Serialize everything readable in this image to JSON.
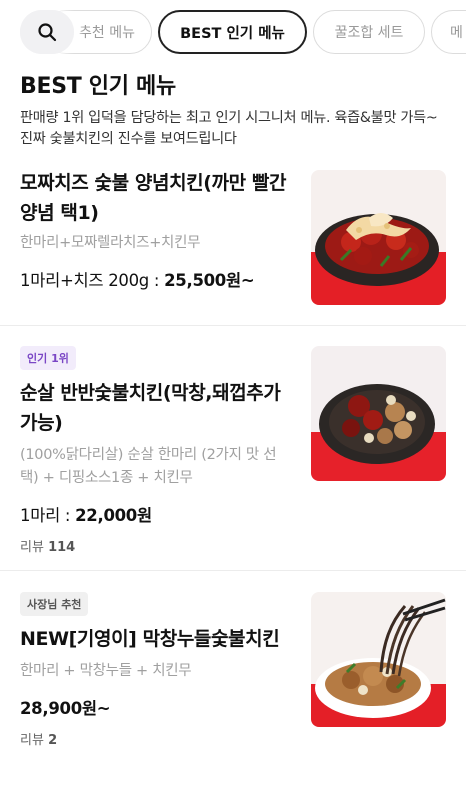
{
  "tabs": {
    "search_icon": "search-icon",
    "items": [
      {
        "label": "추천 메뉴",
        "active": false
      },
      {
        "label": "BEST 인기 메뉴",
        "active": true
      },
      {
        "label": "꿀조합 세트",
        "active": false
      },
      {
        "label": "메",
        "active": false
      }
    ]
  },
  "section": {
    "title": "BEST 인기 메뉴",
    "description": "판매량 1위 입덕을 담당하는 최고 인기 시그니처 메뉴. 육즙&불맛 가득~ 진짜 숯불치킨의 진수를 보여드립니다"
  },
  "menu_items": [
    {
      "name": "모짜치즈 숯불 양념치킨(까만 빨간양념 택1)",
      "description": "한마리+모짜렐라치즈+치킨무",
      "price_prefix": "1마리+치즈 200g : ",
      "price": "25,500원~"
    },
    {
      "badge": "인기 1위",
      "name": "순살 반반숯불치킨(막창,돼껍추가가능)",
      "description": "(100%닭다리살) 순살 한마리 (2가지 맛 선택) + 디핑소스1종 + 치킨무",
      "price_prefix": "1마리 : ",
      "price": "22,000원",
      "review_label": "리뷰",
      "review_count": "114"
    },
    {
      "badge": "사장님 추천",
      "name": "NEW[기영이] 막창누들숯불치킨",
      "description": "한마리 + 막창누들 + 치킨무",
      "price_prefix": "",
      "price": "28,900원~",
      "review_label": "리뷰",
      "review_count": "2"
    }
  ],
  "colors": {
    "accent_purple": "#7a46c5",
    "photo_red": "#e8232a",
    "divider": "#ececec"
  }
}
